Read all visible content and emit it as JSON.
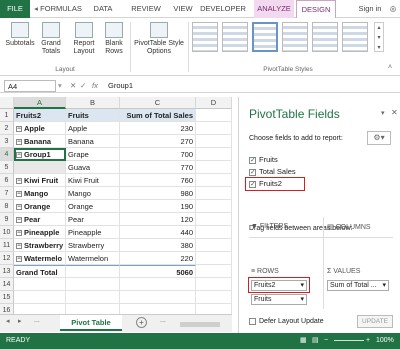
{
  "ribbon": {
    "tabs": [
      "FILE",
      "FORMULAS",
      "DATA",
      "REVIEW",
      "VIEW",
      "DEVELOPER",
      "ANALYZE",
      "DESIGN"
    ],
    "sign_in": "Sign in",
    "buttons": {
      "subtotals": "Subtotals",
      "grand_totals": "Grand Totals",
      "report_layout": "Report Layout",
      "blank_rows": "Blank Rows",
      "pivot_style_options": "PivotTable Style Options"
    },
    "group_labels": {
      "layout": "Layout",
      "pivot_styles": "PivotTable Styles"
    }
  },
  "formula_bar": {
    "name_box": "A4",
    "fx": "fx",
    "value": "Group1"
  },
  "grid": {
    "columns": [
      "A",
      "B",
      "C",
      "D"
    ],
    "row_numbers": [
      "1",
      "2",
      "3",
      "4",
      "5",
      "6",
      "7",
      "8",
      "9",
      "10",
      "11",
      "12",
      "13",
      "14",
      "15",
      "16"
    ],
    "header": [
      "Fruits2",
      "Fruits",
      "Sum of Total Sales"
    ],
    "rows": [
      {
        "a": "Apple",
        "b": "Apple",
        "c": "230",
        "exp": true
      },
      {
        "a": "Banana",
        "b": "Banana",
        "c": "270",
        "exp": true
      },
      {
        "a": "Group1",
        "b": "Grape",
        "c": "700",
        "exp": true
      },
      {
        "a": "",
        "b": "Guava",
        "c": "770",
        "exp": false
      },
      {
        "a": "Kiwi Fruit",
        "b": "Kiwi Fruit",
        "c": "760",
        "exp": true
      },
      {
        "a": "Mango",
        "b": "Mango",
        "c": "980",
        "exp": true
      },
      {
        "a": "Orange",
        "b": "Orange",
        "c": "190",
        "exp": true
      },
      {
        "a": "Pear",
        "b": "Pear",
        "c": "120",
        "exp": true
      },
      {
        "a": "Pineapple",
        "b": "Pineapple",
        "c": "440",
        "exp": true
      },
      {
        "a": "Strawberry",
        "b": "Strawberry",
        "c": "380",
        "exp": true
      },
      {
        "a": "Watermelo",
        "b": "Watermelon",
        "c": "220",
        "exp": true
      }
    ],
    "grand_total_label": "Grand Total",
    "grand_total_value": "5060"
  },
  "sheet_tabs": {
    "active": "Pivot Table",
    "ellipsis": "...",
    "add": "+"
  },
  "pane": {
    "title": "PivotTable Fields",
    "choose_label": "Choose fields to add to report:",
    "fields": [
      {
        "name": "Fruits",
        "checked": true
      },
      {
        "name": "Total Sales",
        "checked": true
      },
      {
        "name": "Fruits2",
        "checked": true
      }
    ],
    "drag_label": "Drag fields between areas below:",
    "filters": "FILTERS",
    "columns": "COLUMNS",
    "rows": "ROWS",
    "values": "VALUES",
    "rows_items": [
      "Fruits2",
      "Fruits"
    ],
    "values_items": [
      "Sum of Total ..."
    ],
    "defer_label": "Defer Layout Update",
    "update_button": "UPDATE"
  },
  "status": {
    "ready": "READY",
    "zoom": "100%"
  },
  "colors": {
    "accent": "#217346",
    "highlight": "#d21f1f"
  }
}
